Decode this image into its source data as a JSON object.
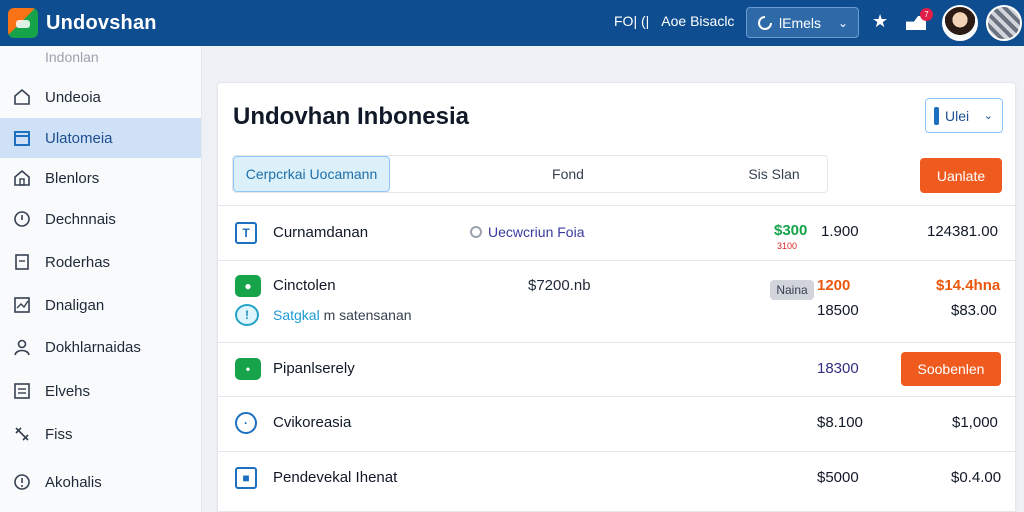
{
  "app": {
    "title": "Undovshan"
  },
  "topbar": {
    "links": [
      "FO| (|",
      "Aoe Bisaclc"
    ],
    "select_label": "lEmels",
    "notification_count": "7"
  },
  "sidebar": {
    "section": "Indonlan",
    "items": [
      {
        "label": "Undeoia",
        "icon": "home-icon"
      },
      {
        "label": "Ulatomeia",
        "icon": "calendar-icon",
        "active": true
      },
      {
        "label": "Blenlors",
        "icon": "home-icon"
      },
      {
        "label": "Dechnnais",
        "icon": "clock-icon"
      },
      {
        "label": "Roderhas",
        "icon": "document-icon"
      },
      {
        "label": "Dnaligan",
        "icon": "chart-icon"
      },
      {
        "label": "Dokhlarnaidas",
        "icon": "user-icon"
      },
      {
        "label": "Elvehs",
        "icon": "list-icon"
      },
      {
        "label": "Fiss",
        "icon": "tools-icon"
      },
      {
        "label": "Akohalis",
        "icon": "info-icon"
      }
    ]
  },
  "main": {
    "title": "Undovhan Inbonesia",
    "filter_label": "Ulei",
    "tabs": [
      "Cerpcrkai Uocamann",
      "Fond",
      "Sis Slan"
    ],
    "update_button": "Uanlate",
    "rows": [
      {
        "name": "Curnamdanan",
        "tag": "Uecwcriun Foia",
        "amount1": "$300",
        "amount1_note": "3100",
        "amount2": "1.900",
        "amount3": "124381.00"
      },
      {
        "name": "Cinctolen",
        "sub_highlight": "Satgkal",
        "sub_rest": " m satensanan",
        "mid_value": "$7200.nb",
        "badge": "Naina",
        "amount1": "1200",
        "amount2": "18500",
        "amount3": "$14.4hna",
        "amount4": "$83.00"
      },
      {
        "name": "Pipanlserely",
        "amount1": "18300",
        "button": "Soobenlen"
      },
      {
        "name": "Cvikoreasia",
        "amount1": "$8.100",
        "amount3": "$1,000"
      },
      {
        "name": "Pendevekal Ihenat",
        "amount1": "$5000",
        "amount3": "$0.4.00"
      }
    ]
  },
  "colors": {
    "topbar": "#0e4d8f",
    "accent": "#ef5b1e",
    "active_nav": "#cfe1f6"
  }
}
